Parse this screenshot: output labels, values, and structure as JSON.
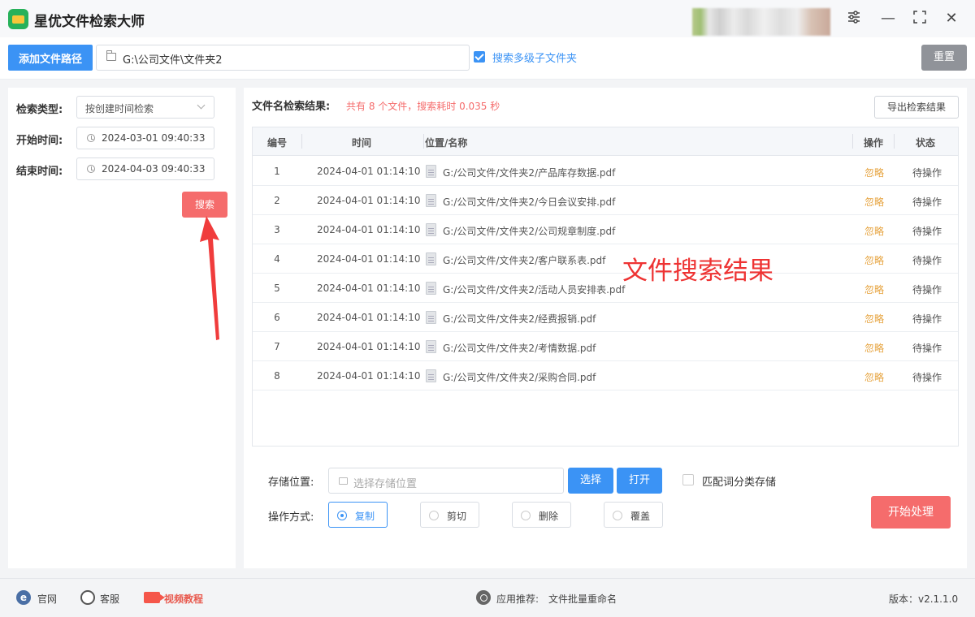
{
  "app": {
    "title": "星优文件检索大师"
  },
  "window_controls": {
    "settings_icon": "sliders-icon",
    "minimize": "—",
    "maximize": "⛶",
    "close": "✕"
  },
  "pathbar": {
    "add_button": "添加文件路径",
    "path_value": "G:\\公司文件\\文件夹2",
    "subfolder_checked": true,
    "subfolder_label": "搜索多级子文件夹",
    "reset_button": "重置"
  },
  "filters": {
    "type_label": "检索类型:",
    "type_value": "按创建时间检索",
    "start_label": "开始时间:",
    "start_value": "2024-03-01 09:40:33",
    "end_label": "结束时间:",
    "end_value": "2024-04-03 09:40:33",
    "search_button": "搜索"
  },
  "results": {
    "title": "文件名检索结果:",
    "summary": "共有 8 个文件，搜索耗时 0.035 秒",
    "export_button": "导出检索结果",
    "columns": [
      "编号",
      "时间",
      "位置/名称",
      "操作",
      "状态"
    ],
    "rows": [
      {
        "num": "1",
        "time": "2024-04-01 01:14:10",
        "path": "G:/公司文件/文件夹2/产品库存数据.pdf",
        "action": "忽略",
        "status": "待操作"
      },
      {
        "num": "2",
        "time": "2024-04-01 01:14:10",
        "path": "G:/公司文件/文件夹2/今日会议安排.pdf",
        "action": "忽略",
        "status": "待操作"
      },
      {
        "num": "3",
        "time": "2024-04-01 01:14:10",
        "path": "G:/公司文件/文件夹2/公司规章制度.pdf",
        "action": "忽略",
        "status": "待操作"
      },
      {
        "num": "4",
        "time": "2024-04-01 01:14:10",
        "path": "G:/公司文件/文件夹2/客户联系表.pdf",
        "action": "忽略",
        "status": "待操作"
      },
      {
        "num": "5",
        "time": "2024-04-01 01:14:10",
        "path": "G:/公司文件/文件夹2/活动人员安排表.pdf",
        "action": "忽略",
        "status": "待操作"
      },
      {
        "num": "6",
        "time": "2024-04-01 01:14:10",
        "path": "G:/公司文件/文件夹2/经费报销.pdf",
        "action": "忽略",
        "status": "待操作"
      },
      {
        "num": "7",
        "time": "2024-04-01 01:14:10",
        "path": "G:/公司文件/文件夹2/考情数据.pdf",
        "action": "忽略",
        "status": "待操作"
      },
      {
        "num": "8",
        "time": "2024-04-01 01:14:10",
        "path": "G:/公司文件/文件夹2/采购合同.pdf",
        "action": "忽略",
        "status": "待操作"
      }
    ],
    "annotation": "文件搜索结果"
  },
  "storage": {
    "label": "存储位置:",
    "placeholder": "选择存储位置",
    "choose_button": "选择",
    "open_button": "打开",
    "classify_checked": false,
    "classify_label": "匹配词分类存储"
  },
  "operation": {
    "label": "操作方式:",
    "options": [
      "复制",
      "剪切",
      "删除",
      "覆盖"
    ],
    "selected": "复制",
    "start_button": "开始处理"
  },
  "footer": {
    "website": "官网",
    "support": "客服",
    "video": "视频教程",
    "recommend_label": "应用推荐:",
    "recommend_app": "文件批量重命名",
    "version": "版本：v2.1.1.0"
  },
  "colors": {
    "primary": "#3b93f5",
    "danger": "#f56c6c",
    "warning": "#e6a23c",
    "neutral": "#909399"
  }
}
